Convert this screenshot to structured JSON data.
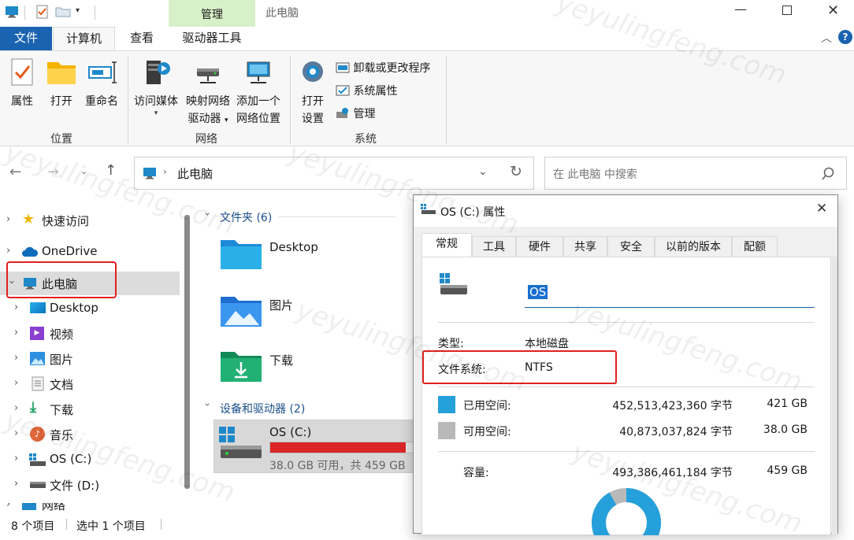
{
  "title": {
    "manage_tab": "管理",
    "window_title": "此电脑"
  },
  "tabs": [
    {
      "label": "文件"
    },
    {
      "label": "计算机"
    },
    {
      "label": "查看"
    },
    {
      "label": "驱动器工具"
    }
  ],
  "ribbon": {
    "location_group": {
      "label": "位置",
      "buttons": [
        "属性",
        "打开",
        "重命名"
      ]
    },
    "network_group": {
      "label": "网络",
      "access_media": "访问媒体",
      "map_drive_1": "映射网络",
      "map_drive_2": "驱动器",
      "add_location_1": "添加一个",
      "add_location_2": "网络位置"
    },
    "system_group": {
      "label": "系统",
      "open_settings_1": "打开",
      "open_settings_2": "设置",
      "uninstall": "卸载或更改程序",
      "sys_props": "系统属性",
      "manage": "管理"
    }
  },
  "address": {
    "path": "此电脑",
    "search_placeholder": "在 此电脑 中搜索"
  },
  "nav": {
    "quick_access": "快速访问",
    "onedrive": "OneDrive",
    "this_pc": "此电脑",
    "children": [
      "Desktop",
      "视频",
      "图片",
      "文档",
      "下载",
      "音乐",
      "OS (C:)",
      "文件 (D:)"
    ],
    "network": "网络"
  },
  "content": {
    "folders_header": "文件夹 (6)",
    "folders": [
      "Desktop",
      "图片",
      "下载"
    ],
    "devices_header": "设备和驱动器 (2)",
    "drive_name": "OS (C:)",
    "drive_info": "38.0 GB 可用，共 459 GB",
    "drive_fill_fraction": 0.917
  },
  "status": {
    "items_count": "8 个项目",
    "selected": "选中 1 个项目"
  },
  "dialog": {
    "title": "OS (C:) 属性",
    "tabs": [
      "常规",
      "工具",
      "硬件",
      "共享",
      "安全",
      "以前的版本",
      "配额"
    ],
    "name_value": "OS",
    "type_label": "类型:",
    "type_value": "本地磁盘",
    "fs_label": "文件系统:",
    "fs_value": "NTFS",
    "used_label": "已用空间:",
    "used_bytes": "452,513,423,360 字节",
    "used_gb": "421 GB",
    "free_label": "可用空间:",
    "free_bytes": "40,873,037,824 字节",
    "free_gb": "38.0 GB",
    "capacity_label": "容量:",
    "capacity_bytes": "493,386,461,184 字节",
    "capacity_gb": "459 GB",
    "used_color": "#26a0da",
    "free_color": "#b9b9b9"
  },
  "watermark": "yeyulingfeng.com"
}
